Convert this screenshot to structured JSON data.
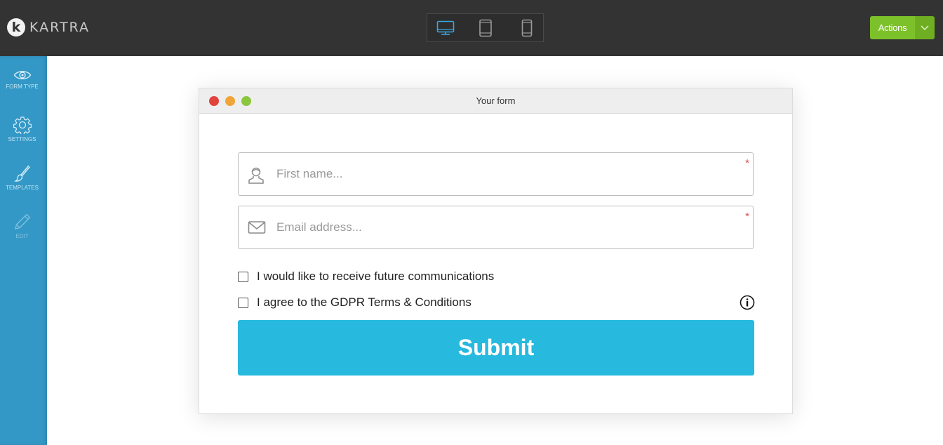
{
  "app": {
    "brand": "KARTRA",
    "logo_letter": "k"
  },
  "topbar": {
    "device_preview": [
      {
        "name": "desktop",
        "icon": "desktop-icon",
        "active": true
      },
      {
        "name": "tablet",
        "icon": "tablet-icon",
        "active": false
      },
      {
        "name": "mobile",
        "icon": "mobile-icon",
        "active": false
      }
    ],
    "actions_label": "Actions"
  },
  "sidebar": {
    "items": [
      {
        "label": "FORM TYPE",
        "icon": "eye-icon",
        "enabled": true
      },
      {
        "label": "SETTINGS",
        "icon": "gear-icon",
        "enabled": true
      },
      {
        "label": "TEMPLATES",
        "icon": "brush-icon",
        "enabled": true
      },
      {
        "label": "EDIT",
        "icon": "pencil-icon",
        "enabled": false
      }
    ]
  },
  "preview_window": {
    "title": "Your form",
    "fields": [
      {
        "placeholder": "First name...",
        "value": "",
        "icon": "user-icon",
        "required": true,
        "required_mark": "*"
      },
      {
        "placeholder": "Email address...",
        "value": "",
        "icon": "envelope-icon",
        "required": true,
        "required_mark": "*"
      }
    ],
    "checkboxes": [
      {
        "label": "I would like to receive future communications",
        "checked": false
      },
      {
        "label": "I agree to the GDPR Terms & Conditions",
        "checked": false
      }
    ],
    "submit_label": "Submit"
  },
  "colors": {
    "topbar": "#333333",
    "sidebar": "#3498c6",
    "actions": "#7dc12a",
    "submit": "#27b9de",
    "active_device": "#3aa6dd",
    "dot_close": "#e0443c",
    "dot_minimize": "#f0a43a",
    "dot_maximize": "#8cc63f"
  }
}
